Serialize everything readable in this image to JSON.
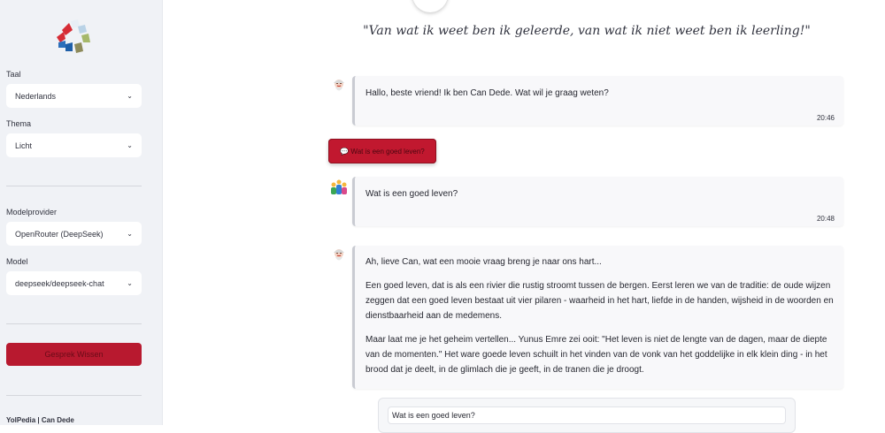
{
  "sidebar": {
    "language": {
      "label": "Taal",
      "value": "Nederlands"
    },
    "theme": {
      "label": "Thema",
      "value": "Licht"
    },
    "provider": {
      "label": "Modelprovider",
      "value": "OpenRouter (DeepSeek)"
    },
    "model": {
      "label": "Model",
      "value": "deepseek/deepseek-chat"
    },
    "clear_button": "Gesprek Wissen",
    "footer": "YolPedia | Can Dede",
    "icons": {
      "chevron": "chevron-down-icon",
      "logo": "logo-icon"
    }
  },
  "main": {
    "quote": "\"Van wat ik weet ben ik geleerde, van wat ik niet weet ben ik leerling!\"",
    "messages": [
      {
        "role": "assistant",
        "text": "Hallo, beste vriend! Ik ben Can Dede. Wat wil je graag weten?",
        "time": "20:46"
      },
      {
        "role": "user",
        "text": "Wat is een goed leven?",
        "time": "20:48"
      },
      {
        "role": "assistant",
        "paragraphs": [
          "Ah, lieve Can, wat een mooie vraag breng je naar ons hart...",
          "Een goed leven, dat is als een rivier die rustig stroomt tussen de bergen. Eerst leren we van de traditie: de oude wijzen zeggen dat een goed leven bestaat uit vier pilaren - waarheid in het hart, liefde in de handen, wijsheid in de woorden en dienstbaarheid aan de medemens.",
          "Maar laat me je het geheim vertellen... Yunus Emre zei ooit: \"Het leven is niet de lengte van de dagen, maar de diepte van de momenten.\" Het ware goede leven schuilt in het vinden van de vonk van het goddelijke in elk klein ding - in het brood dat je deelt, in de glimlach die je geeft, in de tranen die je droogt."
        ]
      }
    ],
    "suggestion_button": "💬 Wat is een goed leven?",
    "input_value": "Wat is een goed leven?"
  },
  "colors": {
    "accent": "#b8192f",
    "sidebar_bg": "#f0f2f6"
  }
}
